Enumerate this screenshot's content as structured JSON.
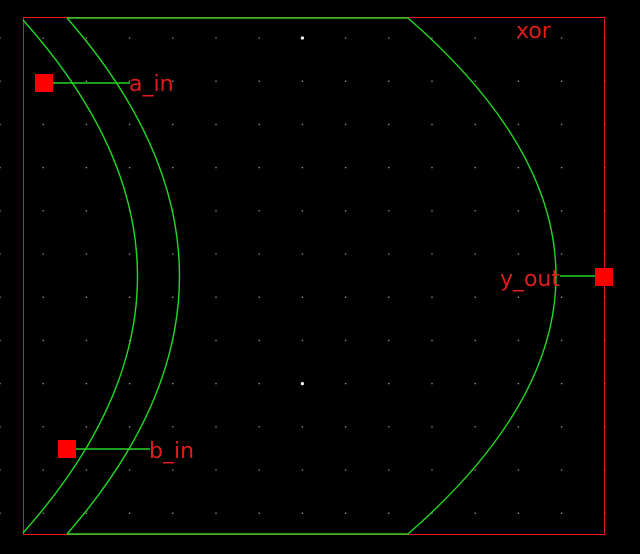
{
  "colors": {
    "background": "#000000",
    "grid_dot": "#8a8a8a",
    "grid_major_dot": "#ffffff",
    "wire": "#22d622",
    "symbol_outline": "#22d622",
    "bounding_box": "#e01c1c",
    "pin": "#ff0000",
    "label_text": "#e01c1c"
  },
  "symbol": {
    "name": "xor",
    "shape": "xor-gate"
  },
  "pins": [
    {
      "name": "a_in",
      "direction": "input"
    },
    {
      "name": "b_in",
      "direction": "input"
    },
    {
      "name": "y_out",
      "direction": "output"
    }
  ]
}
